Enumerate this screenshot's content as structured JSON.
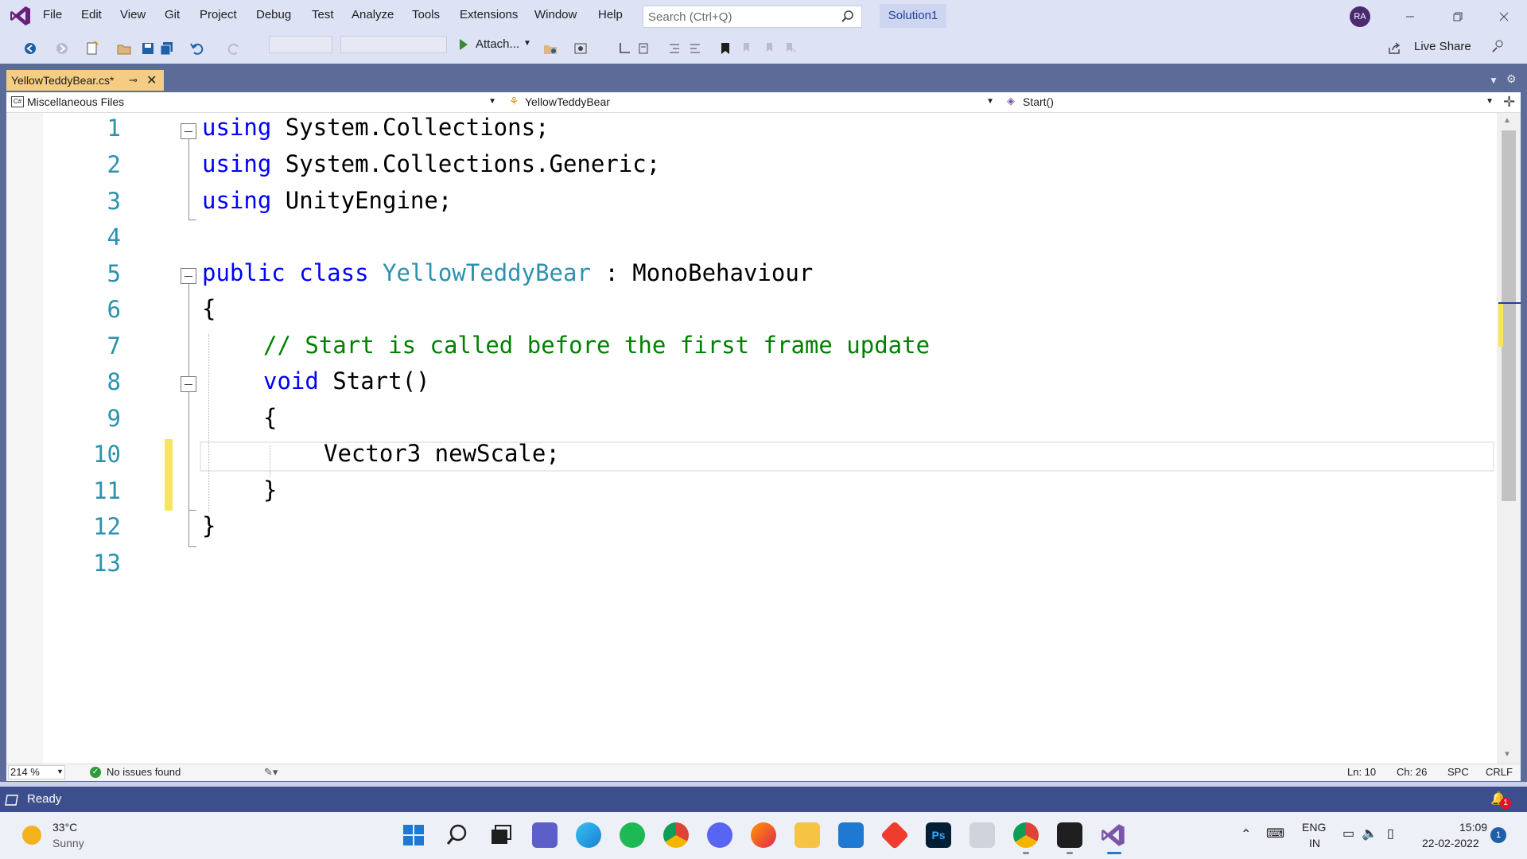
{
  "menu": [
    "File",
    "Edit",
    "View",
    "Git",
    "Project",
    "Debug",
    "Test",
    "Analyze",
    "Tools",
    "Extensions",
    "Window",
    "Help"
  ],
  "search": {
    "placeholder": "Search (Ctrl+Q)"
  },
  "solution_name": "Solution1",
  "user_initials": "RA",
  "toolbar": {
    "attach_label": "Attach...",
    "live_share_label": "Live Share"
  },
  "doc_tab": {
    "title": "YellowTeddyBear.cs*"
  },
  "navbar": {
    "project": "Miscellaneous Files",
    "type": "YellowTeddyBear",
    "member": "Start()"
  },
  "editor": {
    "line_numbers": [
      "1",
      "2",
      "3",
      "4",
      "5",
      "6",
      "7",
      "8",
      "9",
      "10",
      "11",
      "12",
      "13"
    ],
    "lines": {
      "l1": {
        "kw": "using",
        "rest": " System.Collections;"
      },
      "l2": {
        "kw": "using",
        "rest": " System.Collections.Generic;"
      },
      "l3": {
        "kw": "using",
        "rest": " UnityEngine;"
      },
      "l5": {
        "kw1": "public",
        "kw2": "class",
        "type": "YellowTeddyBear",
        "rest": " : MonoBehaviour"
      },
      "l6": {
        "text": "{"
      },
      "l7": {
        "comment": "// Start is called before the first frame update"
      },
      "l8": {
        "kw": "void",
        "rest": " Start()"
      },
      "l9": {
        "text": "{"
      },
      "l10": {
        "text": "Vector3 newScale;"
      },
      "l11": {
        "text": "}"
      },
      "l12": {
        "text": "}"
      }
    }
  },
  "editor_status": {
    "zoom": "214 %",
    "issues": "No issues found",
    "ln": "Ln: 10",
    "ch": "Ch: 26",
    "spc": "SPC",
    "eol": "CRLF"
  },
  "status_bar": {
    "ready": "Ready",
    "notifications": "1"
  },
  "taskbar": {
    "weather_temp": "33°C",
    "weather_desc": "Sunny",
    "lang_line1": "ENG",
    "lang_line2": "IN",
    "time": "15:09",
    "date": "22-02-2022",
    "notification_count": "1",
    "apps": [
      "start-icon",
      "search-icon",
      "task-view-icon",
      "teams-chat-icon",
      "edge-icon",
      "spotify-icon",
      "chrome-icon",
      "discord-icon",
      "firefox-icon",
      "file-explorer-icon",
      "mail-icon",
      "git-icon",
      "photoshop-icon",
      "unity-icon",
      "chrome-profile-icon",
      "unity-editor-icon",
      "visual-studio-icon"
    ]
  },
  "colors": {
    "keyword": "#0000ff",
    "type": "#2b91af",
    "comment": "#008000",
    "accent": "#5d6b99",
    "tab_active": "#f5cc84",
    "change_marker": "#f7e65c"
  }
}
